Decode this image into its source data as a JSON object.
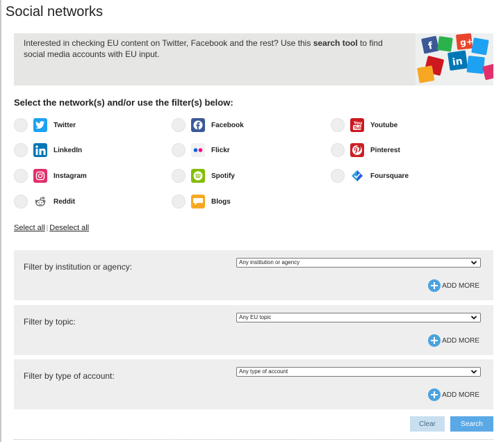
{
  "page": {
    "title": "Social networks"
  },
  "intro": {
    "text_before": "Interested in checking EU content on Twitter, Facebook and the rest? Use this ",
    "text_bold": "search tool",
    "text_after": " to find social media accounts with EU input."
  },
  "networks_heading": "Select the network(s) and/or use the filter(s) below:",
  "networks": [
    {
      "label": "Twitter",
      "icon": "twitter-icon",
      "color": "#1da1f2"
    },
    {
      "label": "Facebook",
      "icon": "facebook-icon",
      "color": "#3b5998"
    },
    {
      "label": "Youtube",
      "icon": "youtube-icon",
      "color": "#cc181e"
    },
    {
      "label": "LinkedIn",
      "icon": "linkedin-icon",
      "color": "#0077b5"
    },
    {
      "label": "Flickr",
      "icon": "flickr-icon",
      "color": "#ff0084"
    },
    {
      "label": "Pinterest",
      "icon": "pinterest-icon",
      "color": "#cb2027"
    },
    {
      "label": "Instagram",
      "icon": "instagram-icon",
      "color": "#e1306c"
    },
    {
      "label": "Spotify",
      "icon": "spotify-icon",
      "color": "#84bd00"
    },
    {
      "label": "Foursquare",
      "icon": "foursquare-icon",
      "color": "#2d5be3"
    },
    {
      "label": "Reddit",
      "icon": "reddit-icon",
      "color": "#555555"
    },
    {
      "label": "Blogs",
      "icon": "blogs-icon",
      "color": "#f7a823"
    }
  ],
  "selection": {
    "select_all": "Select all",
    "separator": "|",
    "deselect_all": "Deselect all"
  },
  "filters": [
    {
      "label": "Filter by institution or agency:",
      "value": "Any institution or agency",
      "add_more": "ADD MORE"
    },
    {
      "label": "Filter by topic:",
      "value": "Any EU topic",
      "add_more": "ADD MORE"
    },
    {
      "label": "Filter by type of account:",
      "value": "Any type of account",
      "add_more": "ADD MORE"
    }
  ],
  "buttons": {
    "clear": "Clear",
    "search": "Search"
  },
  "colors": {
    "accent": "#5aa9e6",
    "add_more": "#4aa3df",
    "intro_bg": "#e6e6e4",
    "filter_bg": "#eeeeee"
  }
}
